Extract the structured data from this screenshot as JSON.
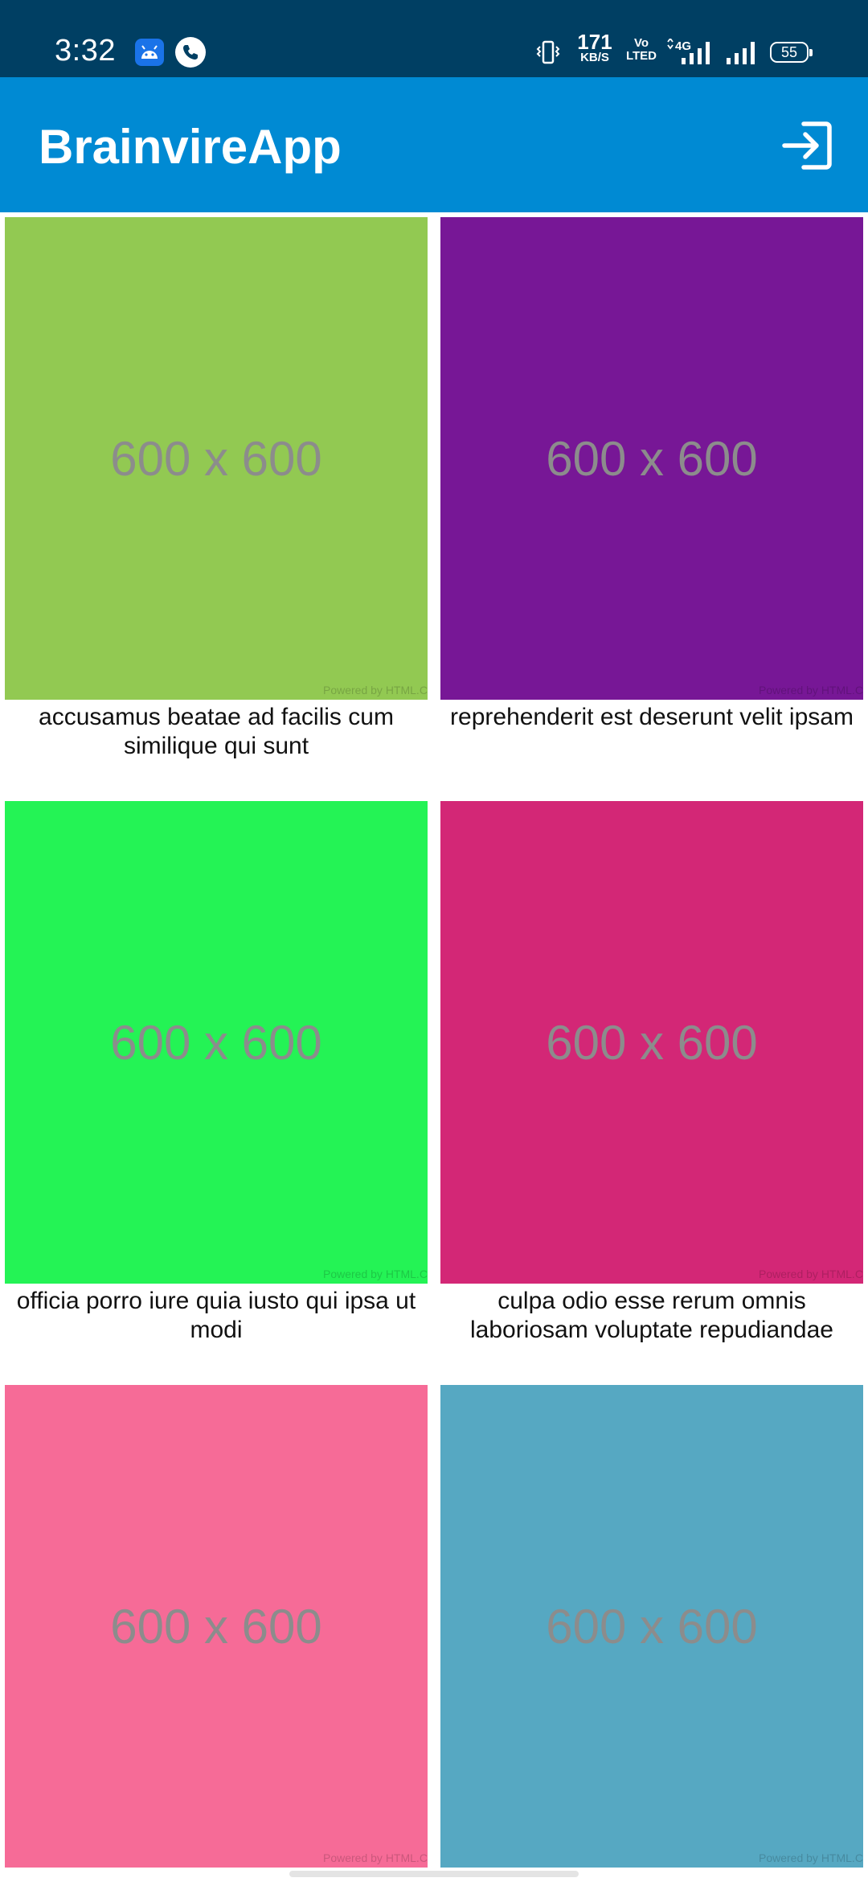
{
  "status_bar": {
    "time": "3:32",
    "net_speed_value": "171",
    "net_speed_unit": "KB/S",
    "volte_line1": "Vo",
    "volte_line2": "LTED",
    "network_type": "4G",
    "battery_level": "55",
    "icons": [
      "android-notification-icon",
      "phone-call-icon",
      "vibrate-icon",
      "signal-4g-icon",
      "signal-icon",
      "battery-icon"
    ]
  },
  "app_bar": {
    "title": "BrainvireApp",
    "action_icon": "logout-icon",
    "background_color": "#008ad3"
  },
  "items": [
    {
      "color": "#92c952",
      "label": "600 x 600",
      "caption": "accusamus beatae ad facilis cum similique qui sunt",
      "watermark": "Powered by HTML.C"
    },
    {
      "color": "#771796",
      "label": "600 x 600",
      "caption": "reprehenderit est deserunt velit ipsam",
      "watermark": "Powered by HTML.C"
    },
    {
      "color": "#24f355",
      "label": "600 x 600",
      "caption": "officia porro iure quia iusto qui ipsa ut modi",
      "watermark": "Powered by HTML.C"
    },
    {
      "color": "#d32776",
      "label": "600 x 600",
      "caption": "culpa odio esse rerum omnis laboriosam voluptate repudiandae",
      "watermark": "Powered by HTML.C"
    },
    {
      "color": "#f66b97",
      "label": "600 x 600",
      "caption": "",
      "watermark": "Powered by HTML.C"
    },
    {
      "color": "#56a8c2",
      "label": "600 x 600",
      "caption": "",
      "watermark": "Powered by HTML.C"
    }
  ]
}
